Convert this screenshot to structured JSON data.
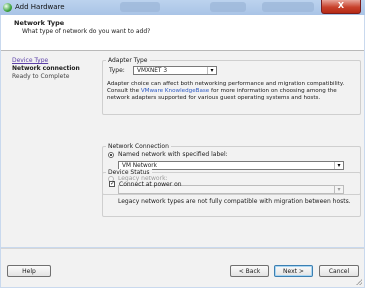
{
  "window": {
    "title": "Add Hardware",
    "close_label": "X"
  },
  "header": {
    "title": "Network Type",
    "subtitle": "What type of network do you want to add?"
  },
  "nav": {
    "items": [
      {
        "label": "Device Type",
        "state": "visited"
      },
      {
        "label": "Network connection",
        "state": "current"
      },
      {
        "label": "Ready to Complete",
        "state": "pending"
      }
    ]
  },
  "adapter": {
    "legend": "Adapter Type",
    "type_label": "Type:",
    "type_value": "VMXNET 3",
    "info_line1": "Adapter choice can affect both networking performance and migration compatibility.",
    "info_line2_pre": "Consult the ",
    "info_link": "VMware KnowledgeBase",
    "info_line2_post": " for more information on choosing among the",
    "info_line3": "network adapters supported for various guest operating systems and hosts."
  },
  "network": {
    "legend": "Network Connection",
    "named_label": "Named network with specified label:",
    "named_selected": true,
    "named_value": "VM Network",
    "legacy_label": "Legacy network:",
    "legacy_selected": false,
    "legacy_value": "",
    "legacy_note": "Legacy network types are not fully compatible with migration between hosts."
  },
  "status": {
    "legend": "Device Status",
    "connect_label": "Connect at power on",
    "connect_checked": true
  },
  "buttons": {
    "help": "Help",
    "back": "< Back",
    "next": "Next >",
    "cancel": "Cancel"
  },
  "colors": {
    "link": "#2a57c2",
    "visited_link": "#5b3fa8",
    "dialog_bg": "#f2f2f2",
    "titlebar": "#bcd3ee",
    "close": "#c8422c"
  }
}
